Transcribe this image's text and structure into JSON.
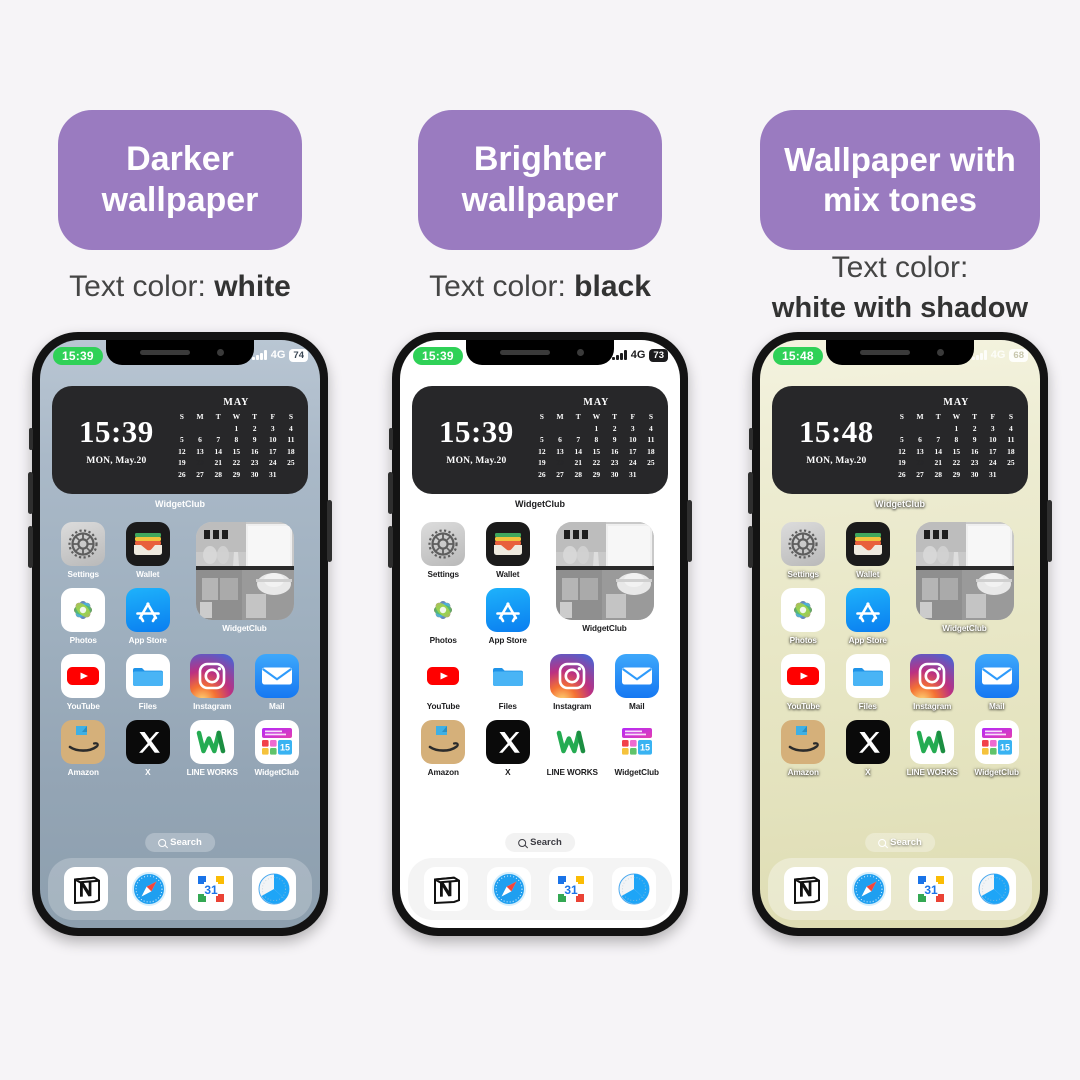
{
  "background_color": "#f6f4f7",
  "badge_color": "#9a7bc0",
  "columns": [
    {
      "badge_lines": [
        "Darker",
        "wallpaper"
      ],
      "caption_prefix": "Text color: ",
      "caption_value": "white",
      "caption_lines": null,
      "wallpaper_style": "dark-sky-gradient",
      "label_style": "white",
      "status": {
        "time": "15:39",
        "network": "4G",
        "battery": "74"
      },
      "widget": {
        "time": "15:39",
        "date": "MON, May.20",
        "month": "MAY",
        "dow": [
          "S",
          "M",
          "T",
          "W",
          "T",
          "F",
          "S"
        ],
        "lead_blank": 3,
        "days": 31,
        "today": 20,
        "label": "WidgetClub"
      },
      "apps": [
        {
          "name": "Settings",
          "icon": "settings-icon"
        },
        {
          "name": "Wallet",
          "icon": "wallet-icon"
        },
        {
          "name": "WidgetClub",
          "icon": "widgetclub-photo-widget",
          "big": true
        },
        {
          "name": "Photos",
          "icon": "photos-icon"
        },
        {
          "name": "App Store",
          "icon": "app-store-icon"
        },
        {
          "name": "YouTube",
          "icon": "youtube-icon"
        },
        {
          "name": "Files",
          "icon": "files-icon"
        },
        {
          "name": "Instagram",
          "icon": "instagram-icon"
        },
        {
          "name": "Mail",
          "icon": "mail-icon"
        },
        {
          "name": "Amazon",
          "icon": "amazon-icon"
        },
        {
          "name": "X",
          "icon": "x-icon"
        },
        {
          "name": "LINE WORKS",
          "icon": "line-works-icon"
        },
        {
          "name": "WidgetClub",
          "icon": "widgetclub-icon"
        }
      ],
      "search_label": "Search",
      "dock": [
        {
          "name": "Notion",
          "icon": "notion-icon"
        },
        {
          "name": "Safari",
          "icon": "safari-icon"
        },
        {
          "name": "Google Calendar",
          "icon": "google-calendar-icon"
        },
        {
          "name": "Clock",
          "icon": "clock-icon"
        }
      ]
    },
    {
      "badge_lines": [
        "Brighter",
        "wallpaper"
      ],
      "caption_prefix": "Text color: ",
      "caption_value": "black",
      "caption_lines": null,
      "wallpaper_style": "white",
      "label_style": "black",
      "status": {
        "time": "15:39",
        "network": "4G",
        "battery": "73"
      },
      "widget": {
        "time": "15:39",
        "date": "MON, May.20",
        "month": "MAY",
        "dow": [
          "S",
          "M",
          "T",
          "W",
          "T",
          "F",
          "S"
        ],
        "lead_blank": 3,
        "days": 31,
        "today": 20,
        "label": "WidgetClub"
      },
      "apps": [
        {
          "name": "Settings",
          "icon": "settings-icon"
        },
        {
          "name": "Wallet",
          "icon": "wallet-icon"
        },
        {
          "name": "WidgetClub",
          "icon": "widgetclub-photo-widget",
          "big": true
        },
        {
          "name": "Photos",
          "icon": "photos-icon"
        },
        {
          "name": "App Store",
          "icon": "app-store-icon"
        },
        {
          "name": "YouTube",
          "icon": "youtube-icon"
        },
        {
          "name": "Files",
          "icon": "files-icon"
        },
        {
          "name": "Instagram",
          "icon": "instagram-icon"
        },
        {
          "name": "Mail",
          "icon": "mail-icon"
        },
        {
          "name": "Amazon",
          "icon": "amazon-icon"
        },
        {
          "name": "X",
          "icon": "x-icon"
        },
        {
          "name": "LINE WORKS",
          "icon": "line-works-icon"
        },
        {
          "name": "WidgetClub",
          "icon": "widgetclub-icon"
        }
      ],
      "search_label": "Search",
      "dock": [
        {
          "name": "Notion",
          "icon": "notion-icon"
        },
        {
          "name": "Safari",
          "icon": "safari-icon"
        },
        {
          "name": "Google Calendar",
          "icon": "google-calendar-icon"
        },
        {
          "name": "Clock",
          "icon": "clock-icon"
        }
      ]
    },
    {
      "badge_lines": [
        "Wallpaper with",
        "mix tones"
      ],
      "caption_prefix": null,
      "caption_value": null,
      "caption_lines": [
        "Text color:",
        "white with shadow"
      ],
      "wallpaper_style": "cream-mix",
      "label_style": "white-shadow",
      "status": {
        "time": "15:48",
        "network": "4G",
        "battery": "68"
      },
      "widget": {
        "time": "15:48",
        "date": "MON, May.20",
        "month": "MAY",
        "dow": [
          "S",
          "M",
          "T",
          "W",
          "T",
          "F",
          "S"
        ],
        "lead_blank": 3,
        "days": 31,
        "today": 20,
        "label": "WidgetClub"
      },
      "apps": [
        {
          "name": "Settings",
          "icon": "settings-icon"
        },
        {
          "name": "Wallet",
          "icon": "wallet-icon"
        },
        {
          "name": "WidgetClub",
          "icon": "widgetclub-photo-widget",
          "big": true
        },
        {
          "name": "Photos",
          "icon": "photos-icon"
        },
        {
          "name": "App Store",
          "icon": "app-store-icon"
        },
        {
          "name": "YouTube",
          "icon": "youtube-icon"
        },
        {
          "name": "Files",
          "icon": "files-icon"
        },
        {
          "name": "Instagram",
          "icon": "instagram-icon"
        },
        {
          "name": "Mail",
          "icon": "mail-icon"
        },
        {
          "name": "Amazon",
          "icon": "amazon-icon"
        },
        {
          "name": "X",
          "icon": "x-icon"
        },
        {
          "name": "LINE WORKS",
          "icon": "line-works-icon"
        },
        {
          "name": "WidgetClub",
          "icon": "widgetclub-icon"
        }
      ],
      "search_label": "Search",
      "dock": [
        {
          "name": "Notion",
          "icon": "notion-icon"
        },
        {
          "name": "Safari",
          "icon": "safari-icon"
        },
        {
          "name": "Google Calendar",
          "icon": "google-calendar-icon"
        },
        {
          "name": "Clock",
          "icon": "clock-icon"
        }
      ]
    }
  ]
}
